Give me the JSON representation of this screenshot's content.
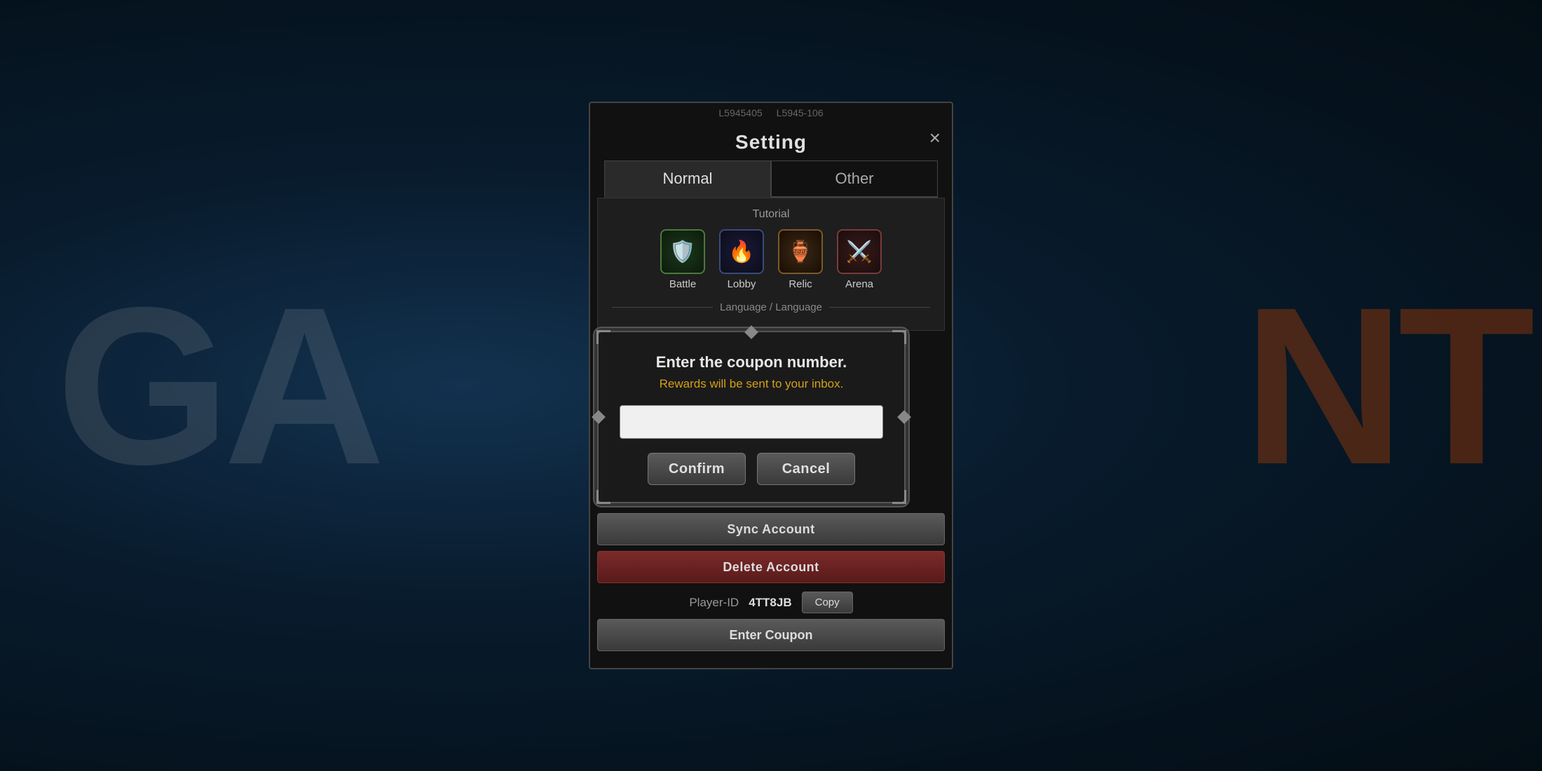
{
  "background": {
    "text_left": "GA",
    "text_right": "NT"
  },
  "setting": {
    "title": "Setting",
    "close_label": "×",
    "tabs": [
      {
        "id": "normal",
        "label": "Normal",
        "active": true
      },
      {
        "id": "other",
        "label": "Other",
        "active": false
      }
    ],
    "tutorial": {
      "section_label": "Tutorial",
      "icons": [
        {
          "id": "battle",
          "label": "Battle",
          "emoji": "🛡️"
        },
        {
          "id": "lobby",
          "label": "Lobby",
          "emoji": "🔥"
        },
        {
          "id": "relic",
          "label": "Relic",
          "emoji": "🏺"
        },
        {
          "id": "arena",
          "label": "Arena",
          "emoji": "⚔️"
        }
      ]
    },
    "language_label": "Language / Language",
    "sync_account_label": "Sync Account",
    "delete_account_label": "Delete Account",
    "player_id_label": "Player-ID",
    "player_id_value": "4TT8JB",
    "copy_label": "Copy",
    "enter_coupon_label": "Enter Coupon"
  },
  "coupon_dialog": {
    "title": "Enter the coupon number.",
    "subtitle": "Rewards will be sent to your inbox.",
    "input_placeholder": "",
    "confirm_label": "Confirm",
    "cancel_label": "Cancel"
  }
}
